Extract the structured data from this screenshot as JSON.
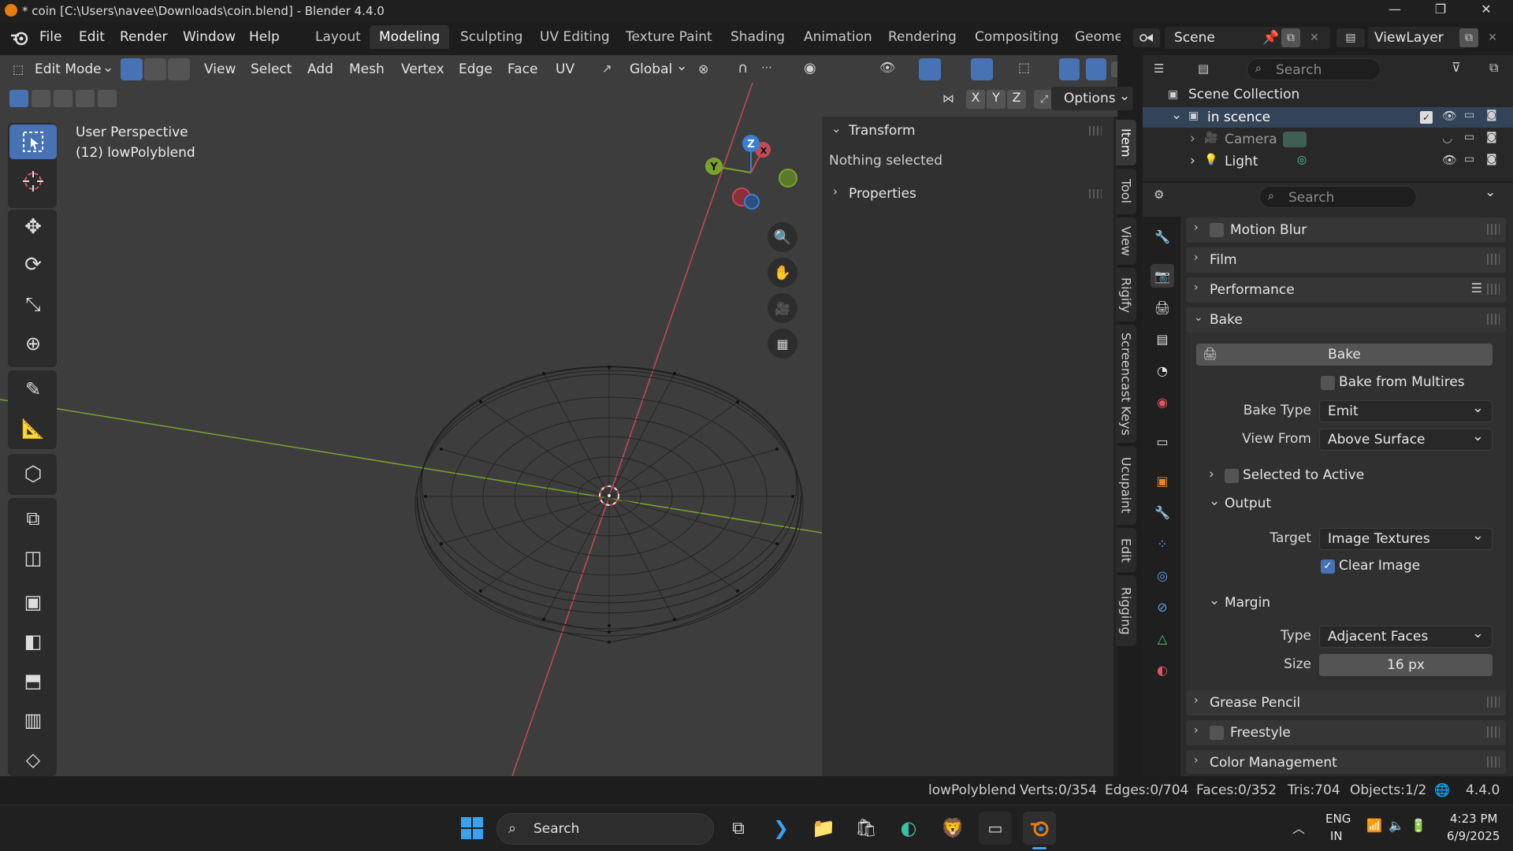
{
  "window": {
    "title": "* coin [C:\\Users\\navee\\Downloads\\coin.blend] - Blender 4.4.0"
  },
  "menu": {
    "items": [
      "File",
      "Edit",
      "Render",
      "Window",
      "Help"
    ]
  },
  "workspaces": {
    "tabs": [
      "Layout",
      "Modeling",
      "Sculpting",
      "UV Editing",
      "Texture Paint",
      "Shading",
      "Animation",
      "Rendering",
      "Compositing",
      "Geome"
    ],
    "active": "Modeling"
  },
  "scene": {
    "name": "Scene",
    "view_layer": "ViewLayer"
  },
  "viewport_header": {
    "mode": "Edit Mode",
    "menus": [
      "View",
      "Select",
      "Add",
      "Mesh",
      "Vertex",
      "Edge",
      "Face",
      "UV"
    ],
    "orientation": "Global",
    "options_label": "Options",
    "axes": [
      "X",
      "Y",
      "Z"
    ]
  },
  "viewport": {
    "view_name": "User Perspective",
    "object_label": "(12) lowPolyblend",
    "gizmo_axes": [
      "Z",
      "Y",
      "X"
    ]
  },
  "npanel": {
    "transform_label": "Transform",
    "nothing_selected": "Nothing selected",
    "properties_label": "Properties",
    "tabs": [
      "Item",
      "Tool",
      "View",
      "Rigify",
      "Screencast Keys",
      "Ucupaint",
      "Edit",
      "Rigging"
    ],
    "active_tab": "Item"
  },
  "outliner": {
    "search_placeholder": "Search",
    "root": "Scene Collection",
    "collection": "in scence",
    "items": [
      "Camera",
      "Light"
    ]
  },
  "properties": {
    "search_placeholder": "Search",
    "panels": {
      "motion_blur": "Motion Blur",
      "film": "Film",
      "performance": "Performance",
      "bake": "Bake",
      "grease_pencil": "Grease Pencil",
      "freestyle": "Freestyle",
      "color_management": "Color Management"
    },
    "bake": {
      "button": "Bake",
      "from_multires": "Bake from Multires",
      "bake_type_label": "Bake Type",
      "bake_type": "Emit",
      "view_from_label": "View From",
      "view_from": "Above Surface",
      "selected_to_active": "Selected to Active",
      "output_label": "Output",
      "target_label": "Target",
      "target": "Image Textures",
      "clear_image": "Clear Image",
      "margin_label": "Margin",
      "type_label": "Type",
      "type": "Adjacent Faces",
      "size_label": "Size",
      "size": "16 px"
    }
  },
  "statusbar": {
    "object": "lowPolyblend",
    "verts": "Verts:0/354",
    "edges": "Edges:0/704",
    "faces": "Faces:0/352",
    "tris": "Tris:704",
    "objects": "Objects:1/2",
    "version": "4.4.0"
  },
  "taskbar": {
    "search_placeholder": "Search",
    "lang": "ENG",
    "region": "IN",
    "time": "4:23 PM",
    "date": "6/9/2025"
  },
  "colors": {
    "accent": "#4772b3",
    "viewport_bg": "#3d3d3d",
    "x_axis": "#c44a55",
    "y_axis": "#7aa32d",
    "z_axis": "#3a7fd6"
  }
}
